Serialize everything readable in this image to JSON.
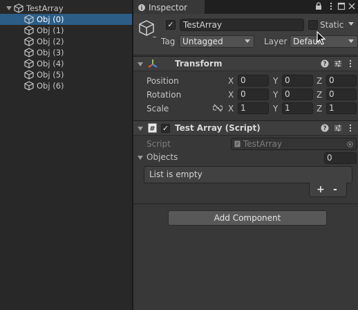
{
  "hierarchy": {
    "root": "TestArray",
    "items": [
      "Obj (0)",
      "Obj (1)",
      "Obj (2)",
      "Obj (3)",
      "Obj (4)",
      "Obj (5)",
      "Obj (6)"
    ],
    "selected_index": 0
  },
  "inspector": {
    "tab_label": "Inspector",
    "object_name": "TestArray",
    "active_checked": true,
    "static_label": "Static",
    "tag_label": "Tag",
    "tag_value": "Untagged",
    "layer_label": "Layer",
    "layer_value": "Default"
  },
  "transform": {
    "title": "Transform",
    "position_label": "Position",
    "rotation_label": "Rotation",
    "scale_label": "Scale",
    "x_label": "X",
    "y_label": "Y",
    "z_label": "Z",
    "position": [
      "0",
      "0",
      "0"
    ],
    "rotation": [
      "0",
      "0",
      "0"
    ],
    "scale": [
      "1",
      "1",
      "1"
    ]
  },
  "script_component": {
    "title": "Test Array (Script)",
    "enabled": true,
    "script_label": "Script",
    "script_value": "TestArray",
    "objects_label": "Objects",
    "objects_count": "0",
    "list_empty_text": "List is empty",
    "add_symbol": "+",
    "remove_symbol": "-"
  },
  "add_component_label": "Add Component",
  "colors": {
    "selection": "#2c5d87",
    "panel": "#383838",
    "header": "#3e3e3e",
    "field": "#2a2a2a"
  }
}
